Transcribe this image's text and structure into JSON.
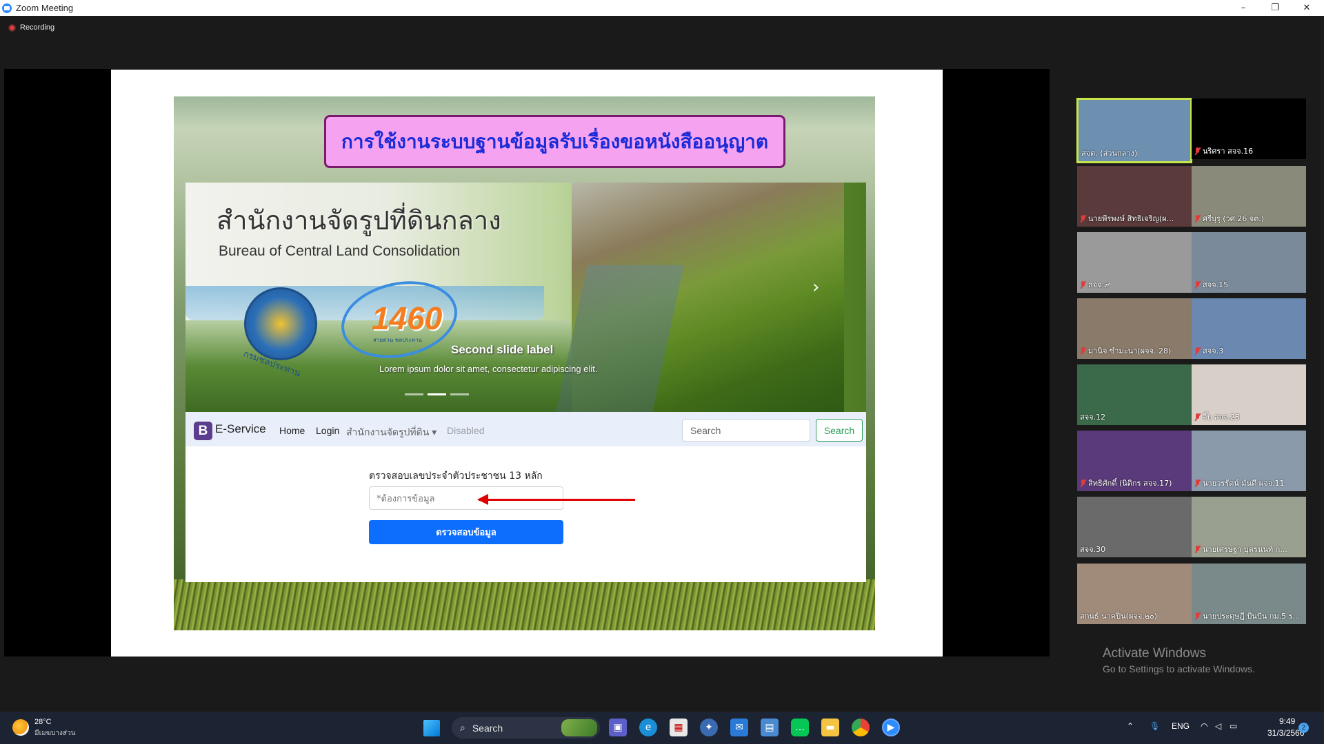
{
  "window": {
    "title": "Zoom Meeting",
    "minimize": "–",
    "restore": "❐",
    "close": "✕"
  },
  "recording_label": "Recording",
  "slide": {
    "title": "การใช้งานระบบฐานข้อมูลรับเรื่องขอหนังสืออนุญาต",
    "banner": {
      "title_th": "สำนักงานจัดรูปที่ดินกลาง",
      "title_en": "Bureau of Central Land Consolidation",
      "seal_text": "กรมชลประทาน",
      "hotline": "1460",
      "hotline_sub": "สายด่วน ชลประทาน",
      "slide_label": "Second slide label",
      "slide_desc": "Lorem ipsum dolor sit amet, consectetur adipiscing elit.",
      "next": "›"
    },
    "navbar": {
      "brand_letter": "B",
      "brand": "E-Service",
      "home": "Home",
      "login": "Login",
      "dropdown": "สำนักงานจัดรูปที่ดิน ▾",
      "disabled": "Disabled",
      "search_placeholder": "Search",
      "search_button": "Search"
    },
    "form": {
      "label": "ตรวจสอบเลขประจำตัวประชาชน 13 หลัก",
      "placeholder": "*ต้องการข้อมูล",
      "button": "ตรวจสอบข้อมูล"
    }
  },
  "participants": [
    {
      "name": "สจด. (ส่วนกลาง)",
      "muted": false,
      "bg": "#6d8fb0"
    },
    {
      "name": "นริศรา สจจ.16",
      "muted": true,
      "bg": "#000000"
    },
    {
      "name": "นายพีรพงษ์ สิทธิเจริญ(ผ...",
      "muted": true,
      "bg": "#5a3a3a"
    },
    {
      "name": "ศรีบุรุ (วศ.26 จต.)",
      "muted": true,
      "bg": "#8a8a7a"
    },
    {
      "name": "สจจ.๙",
      "muted": true,
      "bg": "#9a9a9a"
    },
    {
      "name": "สจจ.15",
      "muted": true,
      "bg": "#7a8a9a"
    },
    {
      "name": "มานิจ ซำมะนา(ผจจ. 28)",
      "muted": true,
      "bg": "#8a7a6a"
    },
    {
      "name": "สจจ.3",
      "muted": true,
      "bg": "#6a88b0"
    },
    {
      "name": "สจจ.12",
      "muted": false,
      "bg": "#3a6a4a"
    },
    {
      "name": "จี๊บ สจจ.23",
      "muted": true,
      "bg": "#d8d0c8"
    },
    {
      "name": "สิทธิศักดิ์ (นิติกร สจจ.17)",
      "muted": true,
      "bg": "#5a3a7a"
    },
    {
      "name": "นายวรรัตน์ มั่นดี ผจจ.11",
      "muted": true,
      "bg": "#8a9aaa"
    },
    {
      "name": "สจจ.30",
      "muted": false,
      "bg": "#6a6a6a"
    },
    {
      "name": "นายเศรษฐา บุตรนนท์ ก...",
      "muted": true,
      "bg": "#9aa090"
    },
    {
      "name": "สกนธ์ นาคปิ่น(ผจจ.๒๐)",
      "muted": false,
      "bg": "#a08a7a"
    },
    {
      "name": "นายประดุษฎี ปั่นป้น กม.5 ร...",
      "muted": true,
      "bg": "#7a8a8a"
    }
  ],
  "activate": {
    "line1": "Activate Windows",
    "line2": "Go to Settings to activate Windows."
  },
  "taskbar": {
    "temp": "28°C",
    "weather": "มีเมฆบางส่วน",
    "search": "Search",
    "lang": "ENG",
    "time": "9:49",
    "date": "31/3/2566",
    "notifications": "2"
  }
}
